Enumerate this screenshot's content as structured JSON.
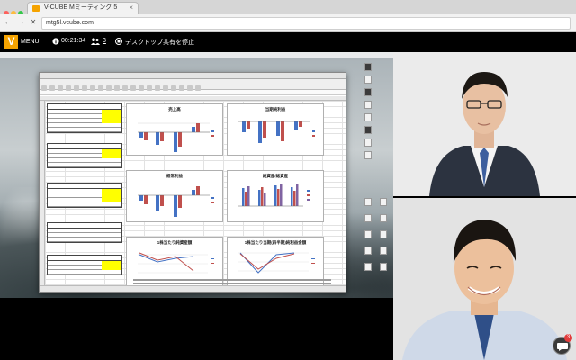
{
  "browser": {
    "tab_title": "V-CUBE Mミーティング 5",
    "tab_close": "×",
    "nav_back": "←",
    "nav_forward": "→",
    "nav_stop": "✕",
    "url": "mtg5l.vcube.com"
  },
  "app_header": {
    "logo_letter": "V",
    "menu_label": "MENU",
    "elapsed_time": "00:21:34",
    "participant_count": "3",
    "desktop_share_stop": "デスクトップ共有を停止",
    "colors": {
      "brand": "#f5a300",
      "control_green": "#3bb34a"
    },
    "controls": [
      "camera-icon",
      "microphone-icon",
      "speaker-icon"
    ]
  },
  "shared_screen": {
    "charts": [
      {
        "title": "売上高"
      },
      {
        "title": "当期純利益"
      },
      {
        "title": "経常利益"
      },
      {
        "title": "純資産/総資産"
      },
      {
        "title": "1株当たり純資産額"
      },
      {
        "title": "1株当たり当期(四半期)純利益金額"
      }
    ]
  },
  "chat": {
    "unread_count": "3"
  }
}
